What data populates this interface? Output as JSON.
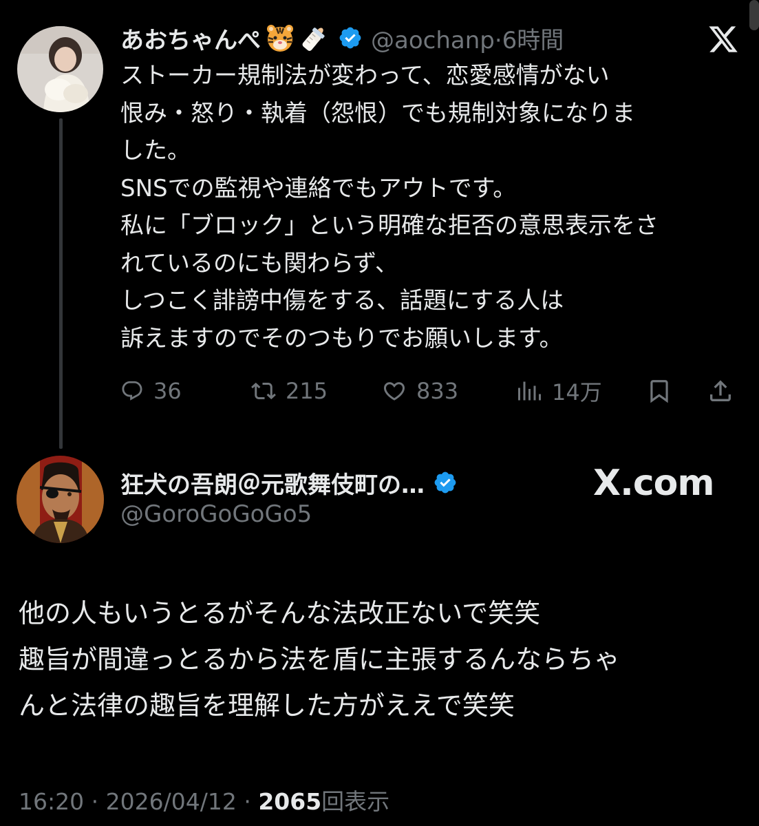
{
  "tweet1": {
    "display_name": "あおちゃんぺ",
    "handle": "@aochanp",
    "separator": "·",
    "time_ago": "6時間",
    "body_lines": [
      "ストーカー規制法が変わって、恋愛感情がない",
      "恨み・怒り・執着（怨恨）でも規制対象になりま",
      "した。",
      "SNSでの監視や連絡でもアウトです。",
      "私に「ブロック」という明確な拒否の意思表示をさ",
      "れているのにも関わらず、",
      "しつこく誹謗中傷をする、話題にする人は",
      "訴えますのでそのつもりでお願いします。"
    ],
    "actions": {
      "replies": "36",
      "reposts": "215",
      "likes": "833",
      "views": "14万"
    }
  },
  "tweet2": {
    "display_name": "狂犬の吾朗＠元歌舞伎町の…",
    "handle": "@GoroGoGoGo5",
    "brand": "X.com",
    "body_lines": [
      "他の人もいうとるがそんな法改正ないで笑笑",
      "趣旨が間違っとるから法を盾に主張するんならちゃ",
      "んと法律の趣旨を理解した方がええで笑笑"
    ],
    "timestamp": "16:20",
    "separator": "·",
    "date": "2026/04/12",
    "view_count": "2065",
    "view_label": "回表示"
  },
  "colors": {
    "background": "#000000",
    "text_primary": "#e7e9ea",
    "text_secondary": "#71767b",
    "verified_blue": "#1d9bf0"
  },
  "icons": [
    "tiger-emoji-icon",
    "baby-bottle-emoji-icon",
    "verified-badge-icon",
    "x-logo-icon",
    "reply-icon",
    "repost-icon",
    "like-icon",
    "views-icon",
    "bookmark-icon",
    "share-icon"
  ]
}
